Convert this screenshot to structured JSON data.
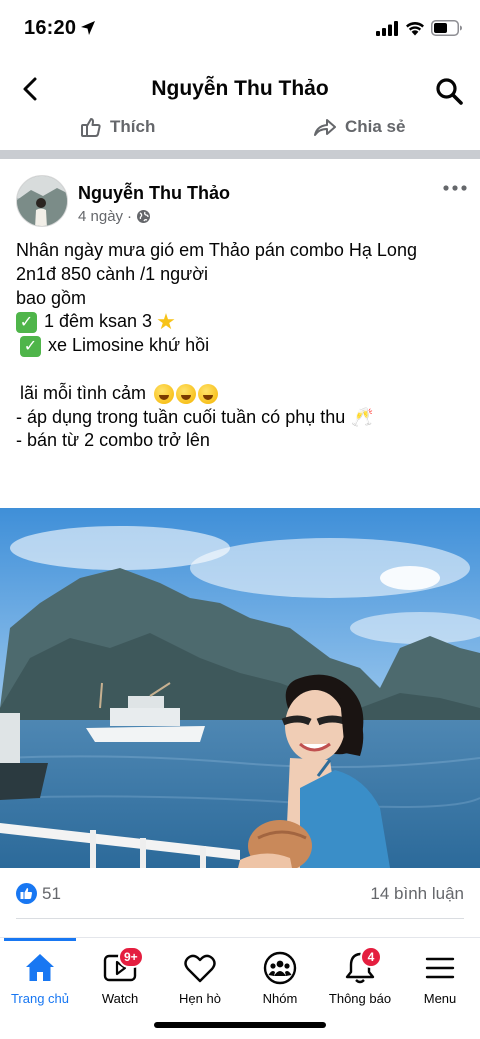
{
  "status_bar": {
    "time": "16:20"
  },
  "header": {
    "title": "Nguyễn Thu Thảo"
  },
  "prev_actions": {
    "like_label": "Thích",
    "share_label": "Chia sẻ"
  },
  "post": {
    "author": "Nguyễn Thu Thảo",
    "time": "4 ngày",
    "lines": [
      "Nhân ngày mưa gió em Thảo pán combo  Hạ Long",
      "2n1đ  850 cành /1 người",
      "bao gồm",
      "1 đêm  ksan 3",
      "xe Limosine khứ hồi",
      "",
      "lãi mỗi tình cảm",
      "- áp dụng trong tuần cuối tuần có phụ thu",
      "- bán từ 2 combo trở lên"
    ],
    "reactions_count": "51",
    "comments": "14 bình luận"
  },
  "tabbar": {
    "tabs": [
      {
        "label": "Trang chủ",
        "icon": "home-icon",
        "badge": ""
      },
      {
        "label": "Watch",
        "icon": "watch-icon",
        "badge": "9+"
      },
      {
        "label": "Hẹn hò",
        "icon": "heart-icon",
        "badge": ""
      },
      {
        "label": "Nhóm",
        "icon": "groups-icon",
        "badge": ""
      },
      {
        "label": "Thông báo",
        "icon": "bell-icon",
        "badge": "4"
      },
      {
        "label": "Menu",
        "icon": "menu-icon",
        "badge": ""
      }
    ]
  },
  "colors": {
    "accent": "#1877f2",
    "badge": "#e41e3f",
    "secondary_text": "#65676b"
  }
}
